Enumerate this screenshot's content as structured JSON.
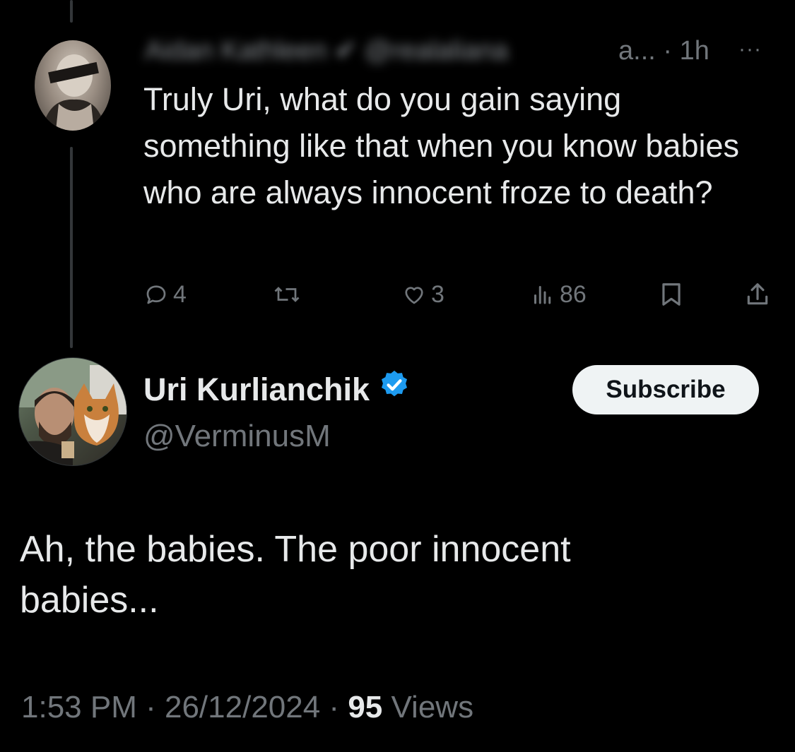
{
  "reply": {
    "author_name_obscured": "Aidan Kathleen",
    "author_handle_obscured": "@realaliana",
    "truncated_suffix": "a...",
    "separator": " · ",
    "time": "1h",
    "more": "···",
    "text": "Truly Uri, what do you gain saying something like that when you know babies who are always innocent froze to death?",
    "actions": {
      "replies": "4",
      "reposts": "",
      "likes": "3",
      "views": "86"
    }
  },
  "main_post": {
    "author_name": "Uri Kurlianchik",
    "author_handle": "@VerminusM",
    "verified": true,
    "subscribe_label": "Subscribe",
    "text_line1": "Ah, the babies. The poor innocent",
    "text_line2": "babies...",
    "time": "1:53 PM",
    "date": "26/12/2024",
    "sep1": " · ",
    "sep2": " · ",
    "views_count": "95",
    "views_label": " Views"
  },
  "colors": {
    "background": "#000000",
    "text_primary": "#e7e9ea",
    "text_secondary": "#71767b",
    "verified_blue": "#1d9bf0",
    "button_bg": "#eff3f4"
  },
  "icons": [
    "reply-icon",
    "repost-icon",
    "like-icon",
    "views-icon",
    "bookmark-icon",
    "share-icon",
    "verified-badge-icon",
    "more-icon"
  ]
}
